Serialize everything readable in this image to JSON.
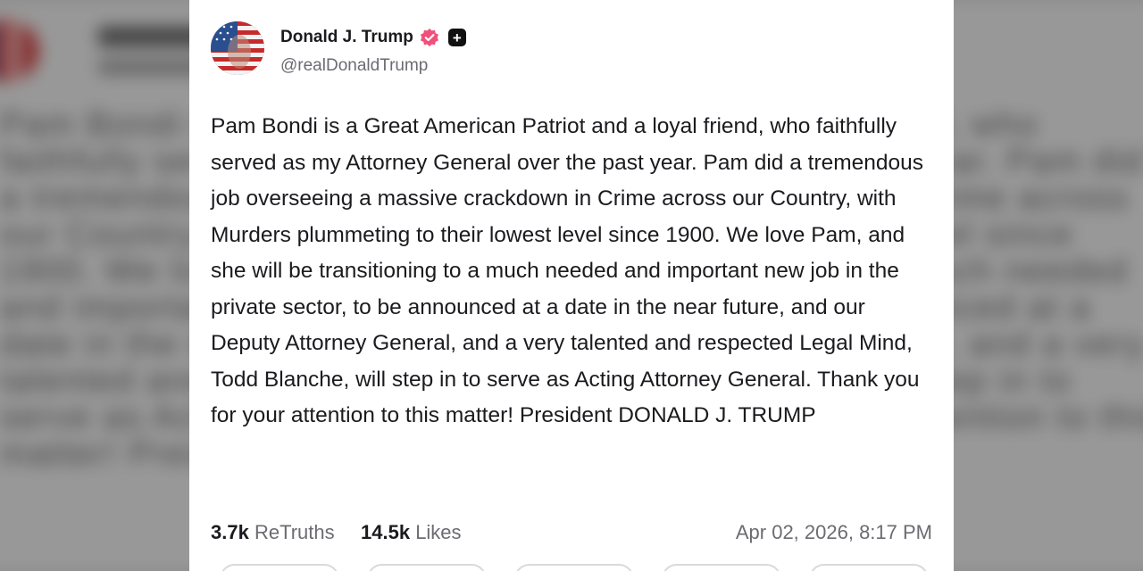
{
  "post": {
    "author_name": "Donald J. Trump",
    "handle": "@realDonaldTrump",
    "body": "Pam Bondi is a Great American Patriot and a loyal friend, who faithfully served as my Attorney General over the past year. Pam did a tremendous job overseeing a massive crackdown in Crime across our Country, with Murders plummeting to their lowest level since 1900. We love Pam, and she will be transitioning to a much needed and important new job in the private sector, to be announced at a date in the near future, and our Deputy Attorney General, and a very talented and respected Legal Mind, Todd Blanche, will step in to serve as Acting Attorney General. Thank you for your attention to this matter! President DONALD J. TRUMP",
    "retruths_count": "3.7k",
    "retruths_label": "ReTruths",
    "likes_count": "14.5k",
    "likes_label": "Likes",
    "timestamp": "Apr 02, 2026, 8:17 PM"
  },
  "icons": {
    "verified": "verified-badge-icon",
    "plus": "plus-icon",
    "avatar": "flag-avatar"
  },
  "colors": {
    "verified_badge": "#f0507a",
    "text_primary": "#1b1b1f",
    "text_secondary": "#6b6b72"
  }
}
